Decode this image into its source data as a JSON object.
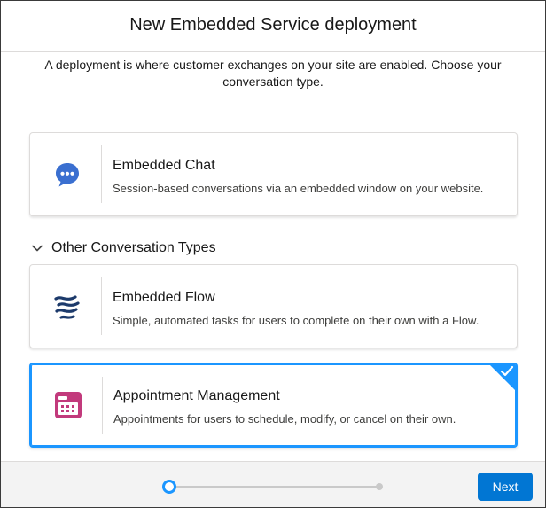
{
  "modal": {
    "title": "New Embedded Service deployment",
    "intro": "A deployment is where customer exchanges on your site are enabled. Choose your conversation type."
  },
  "options": {
    "chat": {
      "title": "Embedded Chat",
      "description": "Session-based conversations via an embedded window on your website.",
      "icon": "chat-bubble-icon",
      "selected": false
    },
    "section": {
      "label": "Other Conversation Types",
      "expanded": true,
      "icon": "chevron-down-icon"
    },
    "flow": {
      "title": "Embedded Flow",
      "description": "Simple, automated tasks for users to complete on their own with a Flow.",
      "icon": "flow-icon",
      "selected": false
    },
    "appointment": {
      "title": "Appointment Management",
      "description": "Appointments for users to schedule, modify, or cancel on their own.",
      "icon": "calendar-icon",
      "selected": true
    }
  },
  "footer": {
    "next_label": "Next",
    "progress": {
      "current_step": 1,
      "total_steps": 2
    }
  },
  "colors": {
    "accent": "#1b96ff",
    "brand_button": "#0176d3",
    "chat_icon": "#3a6fd0",
    "flow_icon": "#1c3a6b",
    "calendar_icon": "#c23a7c"
  }
}
